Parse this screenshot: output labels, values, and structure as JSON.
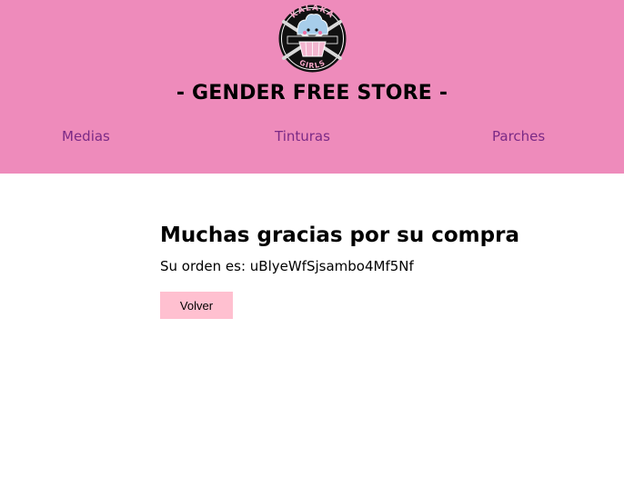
{
  "header": {
    "logo_text_top": "KALAKA",
    "logo_text_bottom": "GIRLS",
    "title": "- GENDER FREE STORE -"
  },
  "nav": {
    "items": [
      {
        "label": "Medias"
      },
      {
        "label": "Tinturas"
      },
      {
        "label": "Parches"
      }
    ]
  },
  "main": {
    "heading": "Muchas gracias por su compra",
    "order_label": "Su orden es: ",
    "order_id": "uBlyeWfSjsambo4Mf5Nf",
    "back_label": "Volver"
  },
  "colors": {
    "header_bg": "#ee8bbb",
    "nav_link": "#7b2a86",
    "button_bg": "#ffc0d0"
  },
  "icons": {
    "logo": "cupcake-logo-icon"
  }
}
